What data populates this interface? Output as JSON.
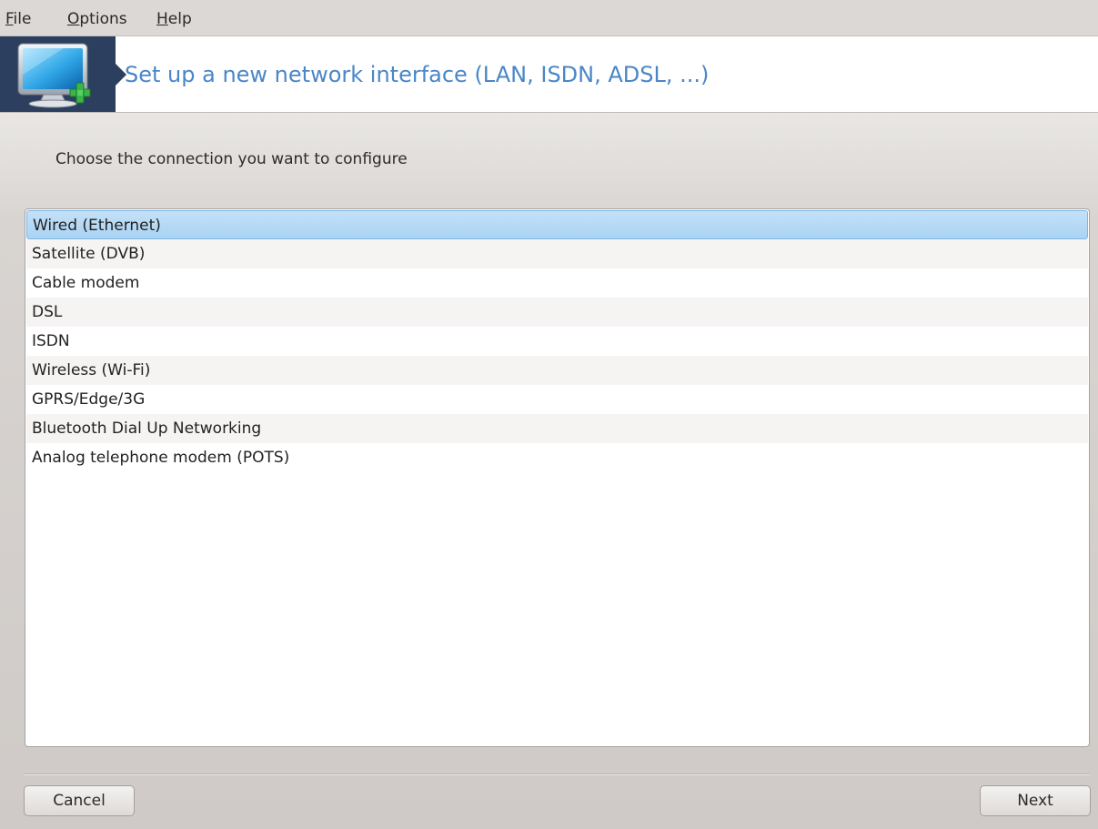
{
  "menubar": {
    "items": [
      {
        "mnemonic": "F",
        "rest": "ile"
      },
      {
        "mnemonic": "O",
        "rest": "ptions"
      },
      {
        "mnemonic": "H",
        "rest": "elp"
      }
    ]
  },
  "banner": {
    "icon": "monitor-add-icon",
    "title": "Set up a new network interface (LAN, ISDN, ADSL, ...)"
  },
  "prompt": "Choose the connection you want to configure",
  "connection_list": {
    "selected_index": 0,
    "items": [
      "Wired (Ethernet)",
      "Satellite (DVB)",
      "Cable modem",
      "DSL",
      "ISDN",
      "Wireless (Wi-Fi)",
      "GPRS/Edge/3G",
      "Bluetooth Dial Up Networking",
      "Analog telephone modem (POTS)"
    ]
  },
  "buttons": {
    "cancel": "Cancel",
    "next": "Next"
  },
  "colors": {
    "title": "#4a86c8",
    "logo_bg": "#2c3f5e",
    "selection": "#a9d3f3"
  }
}
